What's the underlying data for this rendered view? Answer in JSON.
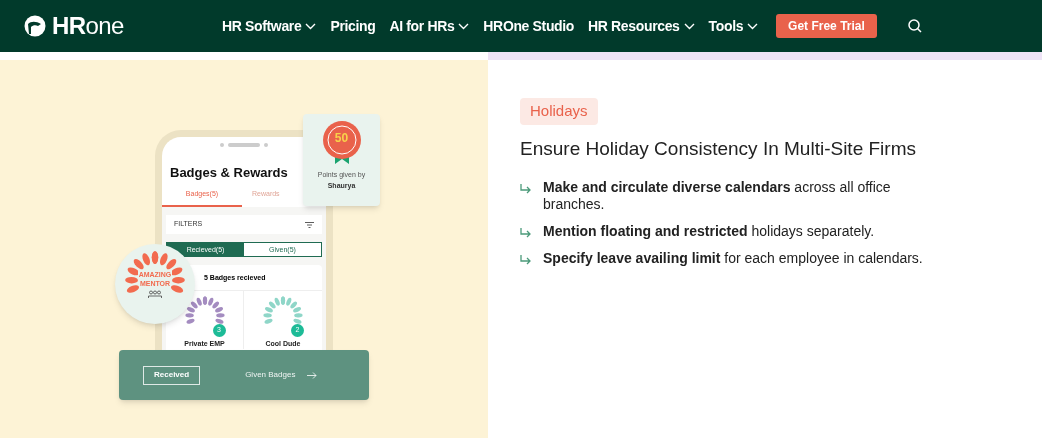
{
  "nav": {
    "logo": "**HR**one",
    "items": [
      {
        "label": "HR Software",
        "dropdown": true
      },
      {
        "label": "Pricing",
        "dropdown": false
      },
      {
        "label": "AI for HRs",
        "dropdown": true
      },
      {
        "label": "HROne Studio",
        "dropdown": false
      },
      {
        "label": "HR Resources",
        "dropdown": true
      },
      {
        "label": "Tools",
        "dropdown": true
      }
    ],
    "cta": "Get Free Trial"
  },
  "illustration": {
    "title": "Badges & Rewards",
    "tabs": [
      {
        "label": "Badges(5)",
        "selected": true
      },
      {
        "label": "Rewards",
        "selected": false
      }
    ],
    "filters": "FILTERS",
    "segments": [
      {
        "label": "Recieved(5)",
        "selected": true
      },
      {
        "label": "Given(5)",
        "selected": false
      }
    ],
    "count": "5 Badges recieved",
    "badges": [
      {
        "name": "Private EMP",
        "count": "3",
        "color": "#a48cc0"
      },
      {
        "name": "Cool Dude",
        "count": "2",
        "color": "#8fd6c8"
      }
    ],
    "points_card": {
      "points": "50",
      "caption": "Points given by",
      "giver": "Shaurya"
    },
    "mentor": [
      "AMAZING",
      "MENTOR"
    ],
    "bar": {
      "received": "Received",
      "given": "Given Badges"
    }
  },
  "content": {
    "tag": "Holidays",
    "heading": "Ensure Holiday Consistency In Multi-Site Firms",
    "bullets": [
      "**Make and circulate diverse calendars** across all office branches.",
      "**Mention floating and restricted** holidays separately.",
      "**Specify leave availing limit** for each employee in calendars."
    ]
  }
}
